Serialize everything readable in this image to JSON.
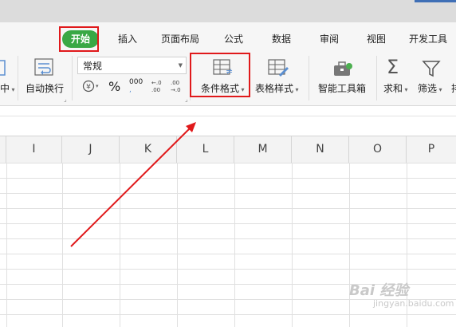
{
  "tabs": {
    "start": "开始",
    "insert": "插入",
    "page_layout": "页面布局",
    "formula": "公式",
    "data": "数据",
    "review": "审阅",
    "view": "视图",
    "developer": "开发工具"
  },
  "ribbon": {
    "merge_center": "中",
    "wrap_text": "自动换行",
    "number_format": "常规",
    "percent": "%",
    "thousands": "000",
    "conditional_format": "条件格式",
    "table_style": "表格样式",
    "smart_toolbox": "智能工具箱",
    "sum": "求和",
    "filter": "筛选",
    "more": "排"
  },
  "columns": [
    "I",
    "J",
    "K",
    "L",
    "M",
    "N",
    "O",
    "P"
  ],
  "watermark": {
    "main": "Bai 经验",
    "sub": "jingyan.baidu.com"
  },
  "colors": {
    "tab_active": "#39a845",
    "highlight_box": "#e0191b",
    "arrow": "#e0191b"
  },
  "icons": [
    "wrap-text-icon",
    "currency-icon",
    "conditional-format-icon",
    "table-style-icon",
    "toolbox-icon",
    "sum-icon",
    "filter-icon"
  ]
}
